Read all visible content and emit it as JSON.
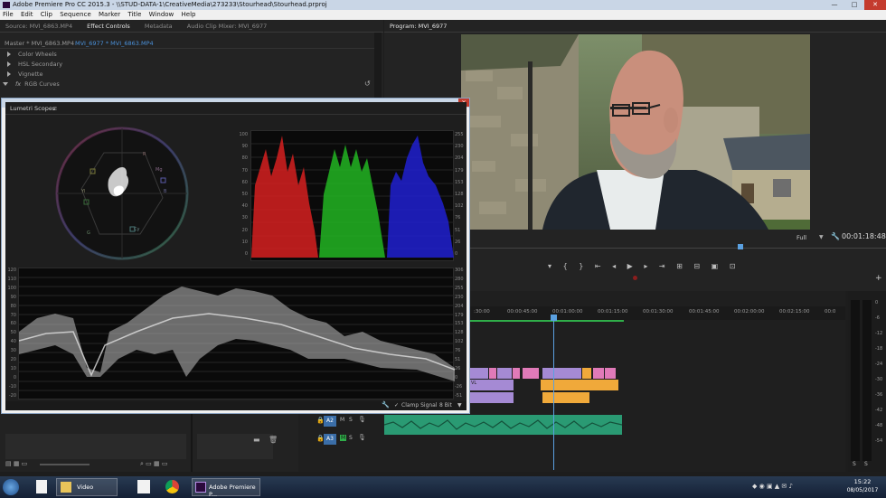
{
  "window": {
    "title": "Adobe Premiere Pro CC 2015.3 - \\\\STUD-DATA-1\\CreativeMedia\\273233\\Stourhead\\Stourhead.prproj",
    "controls": {
      "minimize": "—",
      "maximize": "□",
      "close": "✕"
    }
  },
  "menu": [
    "File",
    "Edit",
    "Clip",
    "Sequence",
    "Marker",
    "Title",
    "Window",
    "Help"
  ],
  "source_panel": {
    "tabs": [
      "Source: MVI_6863.MP4",
      "Effect Controls",
      "Metadata",
      "Audio Clip Mixer: MVI_6977"
    ],
    "active_tab": "Effect Controls",
    "master_label": "Master * MVI_6863.MP4",
    "clip_label": "MVI_6977 * MVI_6863.MP4",
    "rows": [
      "Color Wheels",
      "HSL Secondary",
      "Vignette",
      "RGB Curves"
    ],
    "fx_label": "fx"
  },
  "scopes": {
    "title": "Lumetri Scopes",
    "parade_left_ticks": [
      "100",
      "90",
      "80",
      "70",
      "60",
      "50",
      "40",
      "30",
      "20",
      "10",
      "0"
    ],
    "parade_right_ticks": [
      "255",
      "230",
      "204",
      "179",
      "153",
      "128",
      "102",
      "76",
      "51",
      "26",
      "0"
    ],
    "wave_left_ticks": [
      "120",
      "110",
      "100",
      "90",
      "80",
      "70",
      "60",
      "50",
      "40",
      "30",
      "20",
      "10",
      "0",
      "-10",
      "-20"
    ],
    "wave_right_ticks": [
      "306",
      "280",
      "255",
      "230",
      "204",
      "179",
      "153",
      "128",
      "102",
      "76",
      "51",
      "26",
      "0",
      "-26",
      "-51"
    ],
    "vector_labels": [
      "R",
      "Mg",
      "B",
      "Cy",
      "G",
      "Yl"
    ],
    "clamp_label": "Clamp Signal",
    "bit_depth": "8 Bit"
  },
  "program_monitor": {
    "title": "Program: MVI_6977",
    "zoom": "Full",
    "timecode": "00:01:18:48"
  },
  "timeline": {
    "ruler": [
      ":30:00",
      "00:00:45:00",
      "00:01:00:00",
      "00:01:15:00",
      "00:01:30:00",
      "00:01:45:00",
      "00:02:00:00",
      "00:02:15:00",
      "00:0"
    ],
    "tracks": [
      {
        "name": "A2",
        "m": "M",
        "s": "S"
      },
      {
        "name": "A3",
        "m": "M",
        "s": "S"
      }
    ],
    "clip_label": "VL"
  },
  "meters": {
    "ticks": [
      "0",
      "-6",
      "-12",
      "-18",
      "-24",
      "-30",
      "-36",
      "-42",
      "-48",
      "-54"
    ],
    "solo": [
      "S",
      "S"
    ]
  },
  "taskbar": {
    "items": [
      {
        "name": "Video"
      },
      {
        "name": "Adobe Premiere P..."
      }
    ],
    "time": "15:22",
    "date": "08/05/2017"
  }
}
